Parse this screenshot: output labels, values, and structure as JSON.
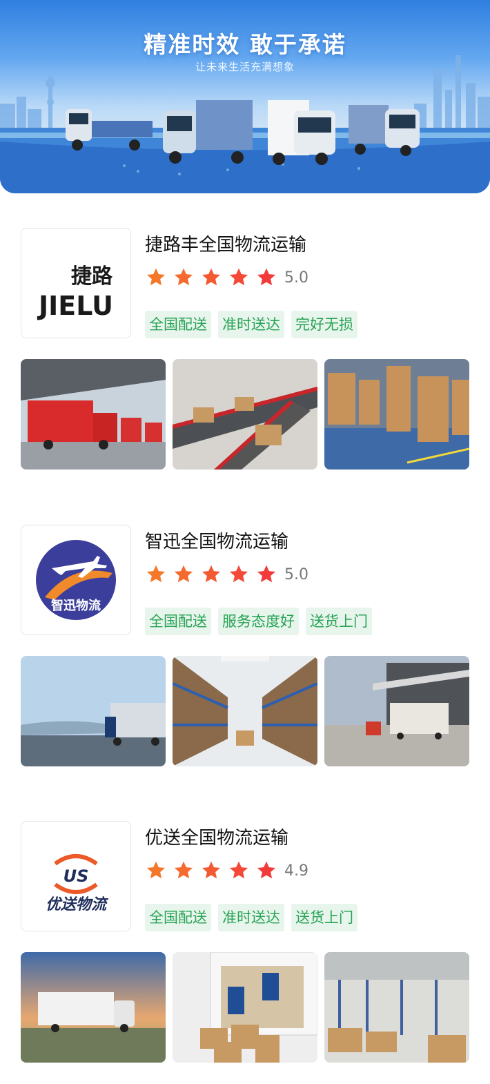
{
  "banner": {
    "title": "精准时效 敢于承诺",
    "subtitle": "让未来生活充满想象"
  },
  "companies": [
    {
      "name": "捷路丰全国物流运输",
      "logo_text_cn": "捷路",
      "logo_text_en": "JIELU",
      "rating_stars": 5,
      "score": "5.0",
      "tags": [
        "全国配送",
        "准时送达",
        "完好无损"
      ],
      "photos": [
        "red-trucks-loading-dock",
        "conveyor-belt-parcels",
        "warehouse-pallets-worker"
      ]
    },
    {
      "name": "智迅全国物流运输",
      "logo_text_cn": "智迅物流",
      "rating_stars": 5,
      "score": "5.0",
      "tags": [
        "全国配送",
        "服务态度好",
        "送货上门"
      ],
      "photos": [
        "truck-on-highway",
        "warehouse-aisle-shelves",
        "truck-at-warehouse-forklift"
      ]
    },
    {
      "name": "优送全国物流运输",
      "logo_text_cn": "优送物流",
      "logo_text_en": "US",
      "rating_stars": 5,
      "score": "4.9",
      "tags": [
        "全国配送",
        "准时送达",
        "送货上门"
      ],
      "photos": [
        "white-truck-motion-blur",
        "van-delivery-workers",
        "warehouse-boxes-shelving"
      ]
    }
  ],
  "colors": {
    "star_orange": "#f5782a",
    "star_red": "#f23a3a",
    "tag_bg": "#e8f5ec",
    "tag_text": "#27a355"
  }
}
